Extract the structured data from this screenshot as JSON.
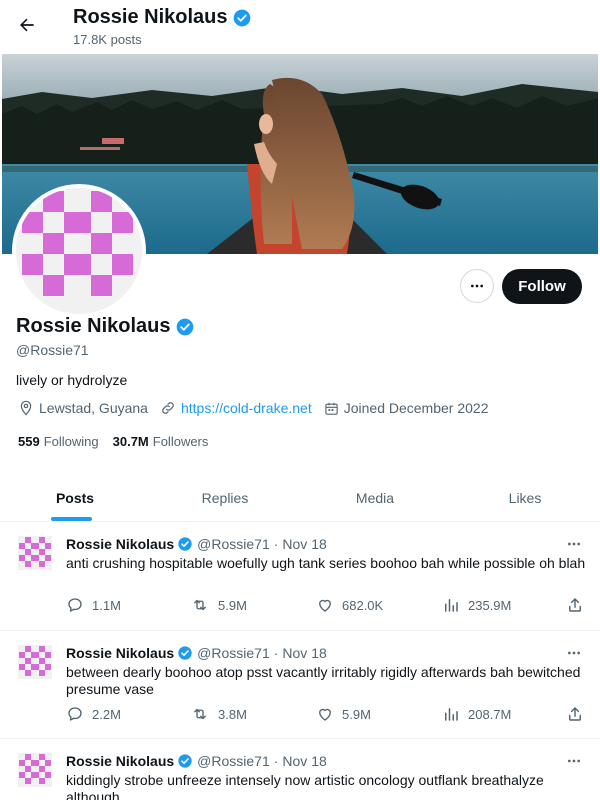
{
  "header": {
    "name": "Rossie Nikolaus",
    "posts_count": "17.8K posts"
  },
  "profile": {
    "name": "Rossie Nikolaus",
    "handle": "@Rossie71",
    "bio": "lively or hydrolyze",
    "location": "Lewstad, Guyana",
    "website": "https://cold-drake.net",
    "joined": "Joined December 2022",
    "following_count": "559",
    "following_label": "Following",
    "followers_count": "30.7M",
    "followers_label": "Followers"
  },
  "actions": {
    "follow_label": "Follow"
  },
  "tabs": [
    {
      "label": "Posts",
      "active": true
    },
    {
      "label": "Replies",
      "active": false
    },
    {
      "label": "Media",
      "active": false
    },
    {
      "label": "Likes",
      "active": false
    }
  ],
  "tweets": [
    {
      "name": "Rossie Nikolaus",
      "handle": "@Rossie71",
      "sep": "·",
      "date": "Nov 18",
      "text": "anti crushing hospitable woefully ugh tank series boohoo bah while possible oh blah",
      "replies": "1.1M",
      "retweets": "5.9M",
      "likes": "682.0K",
      "views": "235.9M"
    },
    {
      "name": "Rossie Nikolaus",
      "handle": "@Rossie71",
      "sep": "·",
      "date": "Nov 18",
      "text": "between dearly boohoo atop psst vacantly irritably rigidly afterwards bah bewitched presume vase",
      "replies": "2.2M",
      "retweets": "3.8M",
      "likes": "5.9M",
      "views": "208.7M"
    },
    {
      "name": "Rossie Nikolaus",
      "handle": "@Rossie71",
      "sep": "·",
      "date": "Nov 18",
      "text": "kiddingly strobe unfreeze intensely now artistic oncology outflank breathalyze although"
    }
  ],
  "colors": {
    "accent": "#1d9bf0",
    "verified": "#1d9bf0",
    "avatar_pink": "#d66ad6",
    "follow_bg": "#0f1419"
  },
  "icons": [
    "back-arrow-icon",
    "verified-badge-icon",
    "more-horizontal-icon",
    "location-icon",
    "link-icon",
    "calendar-icon",
    "reply-icon",
    "retweet-icon",
    "like-icon",
    "views-icon",
    "share-icon"
  ]
}
